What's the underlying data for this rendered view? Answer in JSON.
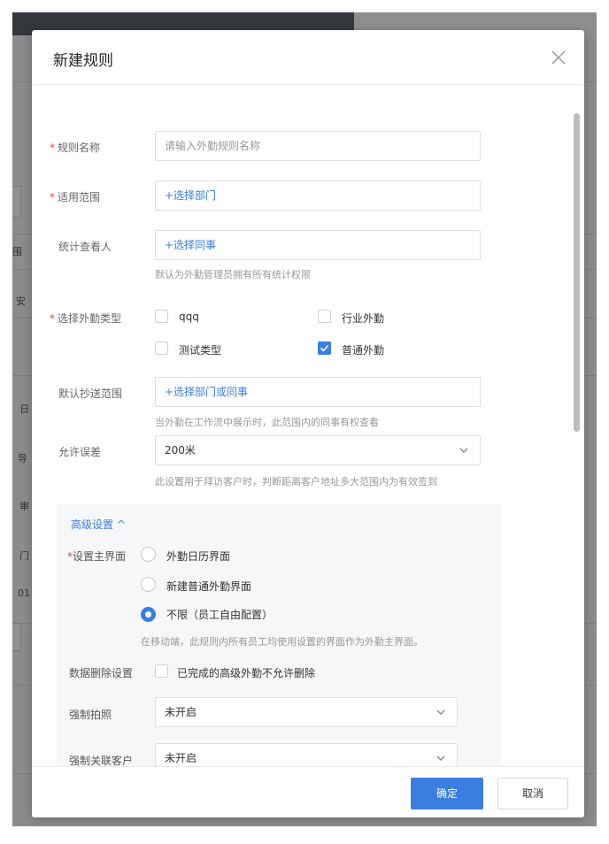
{
  "background": {
    "fragments": [
      "围",
      "安",
      "日",
      "导",
      "审",
      "门",
      "01"
    ]
  },
  "dialog": {
    "title": "新建规则",
    "close_icon": "close-icon"
  },
  "form": {
    "rule_name": {
      "required": "*",
      "label": "规则名称",
      "placeholder": "请输入外勤规则名称"
    },
    "scope": {
      "required": "*",
      "label": "适用范围",
      "value": "+选择部门"
    },
    "viewer": {
      "label": "统计查看人",
      "value": "+选择同事",
      "hint": "默认为外勤管理员拥有所有统计权限"
    },
    "types": {
      "required": "*",
      "label": "选择外勤类型",
      "options": [
        {
          "label": "qqq",
          "checked": false
        },
        {
          "label": "行业外勤",
          "checked": false
        },
        {
          "label": "测试类型",
          "checked": false
        },
        {
          "label": "普通外勤",
          "checked": true
        }
      ]
    },
    "cc": {
      "label": "默认抄送范围",
      "value": "+选择部门或同事",
      "hint": "当外勤在工作流中展示时，此范围内的同事有权查看"
    },
    "tolerance": {
      "label": "允许误差",
      "value": "200米",
      "hint": "此设置用于拜访客户时，判断距离客户地址多大范围内为有效签到"
    }
  },
  "advanced": {
    "toggle_label": "高级设置 ^",
    "main_ui": {
      "required": "*",
      "label": "设置主界面",
      "options": [
        {
          "label": "外勤日历界面",
          "selected": false
        },
        {
          "label": "新建普通外勤界面",
          "selected": false
        },
        {
          "label": "不限（员工自由配置）",
          "selected": true
        }
      ],
      "hint": "在移动端，此规则内所有员工均使用设置的界面作为外勤主界面。"
    },
    "delete": {
      "label": "数据删除设置",
      "checkbox_label": "已完成的高级外勤不允许删除",
      "checked": false
    },
    "photo": {
      "label": "强制拍照",
      "value": "未开启"
    },
    "customer": {
      "label": "强制关联客户",
      "value": "未开启"
    }
  },
  "footer": {
    "ok_label": "确定",
    "cancel_label": "取消"
  },
  "colors": {
    "accent": "#3a7ee0",
    "required": "#e0443b"
  }
}
